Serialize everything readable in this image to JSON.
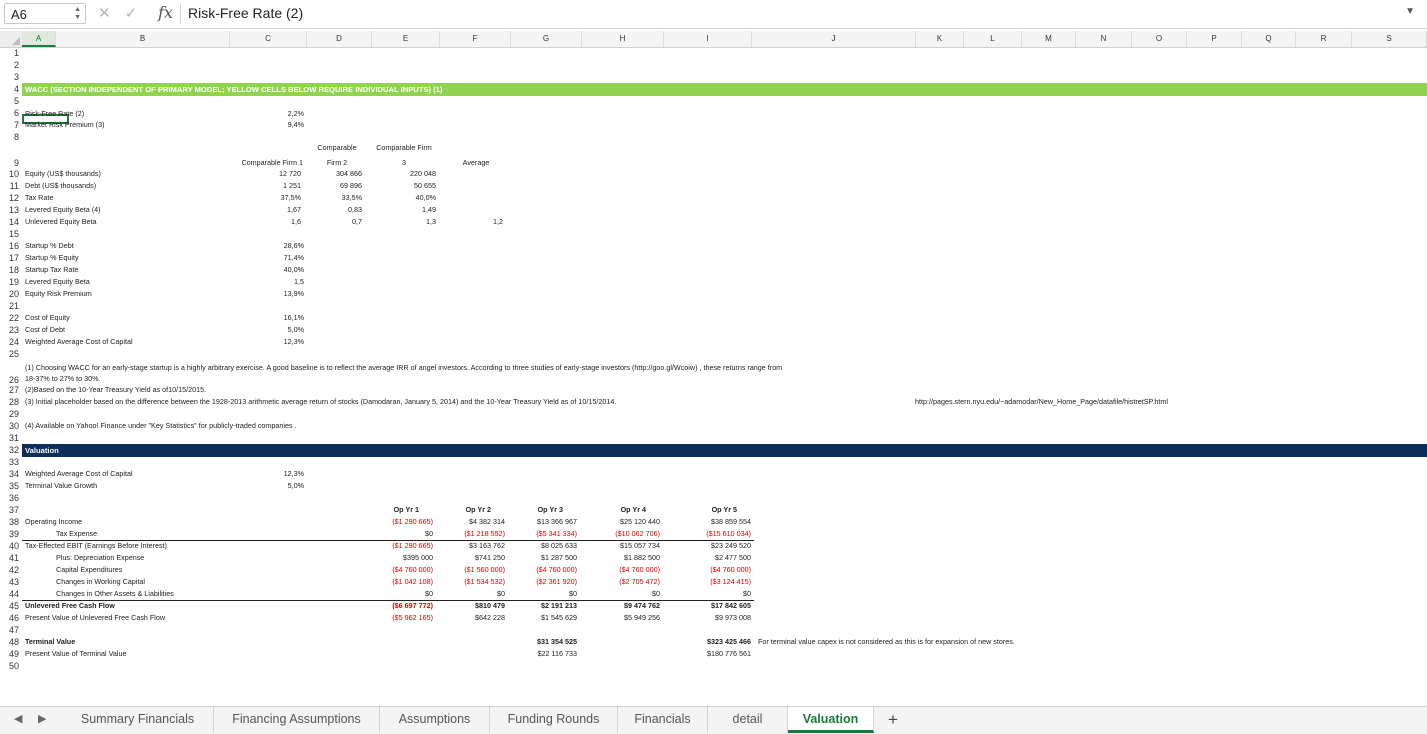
{
  "formula_bar": {
    "cell_ref": "A6",
    "cancel_icon": "✕",
    "confirm_icon": "✓",
    "fx": "fx",
    "content": "Risk-Free Rate (2)"
  },
  "columns": [
    "A",
    "B",
    "C",
    "D",
    "E",
    "F",
    "G",
    "H",
    "I",
    "J",
    "K",
    "L",
    "M",
    "N",
    "O",
    "P",
    "Q",
    "R",
    "S"
  ],
  "rows": [
    "1",
    "2",
    "3",
    "4",
    "5",
    "6",
    "7",
    "8",
    "9",
    "10",
    "11",
    "12",
    "13",
    "14",
    "15",
    "16",
    "17",
    "18",
    "19",
    "20",
    "21",
    "22",
    "23",
    "24",
    "25",
    "26",
    "27",
    "28",
    "29",
    "30",
    "31",
    "32",
    "33",
    "34",
    "35",
    "36",
    "37",
    "38",
    "39",
    "40",
    "41",
    "42",
    "43",
    "44",
    "45",
    "46",
    "47",
    "48",
    "49",
    "50"
  ],
  "wacc": {
    "header": "WACC (SECTION INDEPENDENT OF PRIMARY MODEL; YELLOW CELLS BELOW REQUIRE INDIVIDUAL INPUTS) (1)",
    "risk_free_label": "Risk-Free Rate (2)",
    "risk_free": "2,2%",
    "mrp_label": "Market Risk Premium (3)",
    "mrp": "9,4%",
    "comp1_header": "Comparable Firm 1",
    "comp2_header_a": "Comparable",
    "comp2_header_b": "Firm 2",
    "comp3_header_a": "Comparable Firm",
    "comp3_header_b": "3",
    "avg_header": "Average",
    "rows": [
      {
        "label": "Equity (US$ thousands)",
        "c1": "12 720",
        "c2": "304 866",
        "c3": "220 048",
        "avg": ""
      },
      {
        "label": "Debt (US$ thousands)",
        "c1": "1 251",
        "c2": "69 896",
        "c3": "50 655",
        "avg": ""
      },
      {
        "label": "Tax Rate",
        "c1": "37,5%",
        "c2": "33,5%",
        "c3": "40,0%",
        "avg": ""
      },
      {
        "label": "Levered Equity Beta (4)",
        "c1": "1,67",
        "c2": "0,83",
        "c3": "1,49",
        "avg": ""
      },
      {
        "label": "Unlevered Equity Beta",
        "c1": "1,6",
        "c2": "0,7",
        "c3": "1,3",
        "avg": "1,2"
      }
    ],
    "startup": [
      {
        "label": "Startup % Debt",
        "value": "28,6%"
      },
      {
        "label": "Startup % Equity",
        "value": "71,4%"
      },
      {
        "label": "Startup Tax Rate",
        "value": "40,0%"
      },
      {
        "label": "Levered Equity Beta",
        "value": "1,5"
      },
      {
        "label": "Equity Risk Premium",
        "value": "13,9%"
      }
    ],
    "costs": [
      {
        "label": "Cost of Equity",
        "value": "16,1%"
      },
      {
        "label": "Cost of Debt",
        "value": "5,0%"
      },
      {
        "label": "Weighted Average Cost of Capital",
        "value": "12,3%"
      }
    ],
    "notes": {
      "n1a": "(1) Choosing WACC for an early-stage startup is a highly arbitrary exercise.  A good baseline is to reflect the average IRR of angel investors.  According to three studies of early-stage investors (http://goo.gl/Wcoiw) , these returns range from",
      "n1b": "18-37% to 27% to 30%.",
      "n2": "(2)Based on the 10-Year Treasury Yield as of10/15/2015.",
      "n3": "(3) Initial placeholder based on the difference between the 1928-2013 arithmetic average return of stocks (Damodaran, January 5, 2014) and the 10-Year Treasury Yield as of 10/15/2014.",
      "n3_url": "http://pages.stern.nyu.edu/~adamodar/New_Home_Page/datafile/histretSP.html",
      "n4": "(4) Available on Yahoo! Finance under \"Key Statistics\" for publicly-traded companies ."
    }
  },
  "valuation": {
    "header": "Valuation",
    "wacc_label": "Weighted Average Cost of Capital",
    "wacc": "12,3%",
    "tvg_label": "Terminal Value Growth",
    "tvg": "5,0%",
    "years": [
      "Op Yr 1",
      "Op Yr 2",
      "Op Yr 3",
      "Op Yr 4",
      "Op Yr 5"
    ],
    "lines": [
      {
        "label": "Operating Income",
        "indent": false,
        "bold": false,
        "values": [
          "($1 290 665)",
          "$4 382 314",
          "$13 366 967",
          "$25 120 440",
          "$38 859 554"
        ],
        "neg": [
          true,
          false,
          false,
          false,
          false
        ]
      },
      {
        "label": "Tax Expense",
        "indent": true,
        "bold": false,
        "values": [
          "$0",
          "($1 218 552)",
          "($5 341 334)",
          "($10 062 706)",
          "($15 610 034)"
        ],
        "neg": [
          false,
          true,
          true,
          true,
          true
        ]
      },
      {
        "label": "Tax-Effected EBIT (Earnings Before Interest)",
        "indent": false,
        "bold": false,
        "values": [
          "($1 290 665)",
          "$3 163 762",
          "$8 025 633",
          "$15 057 734",
          "$23 249 520"
        ],
        "neg": [
          true,
          false,
          false,
          false,
          false
        ]
      },
      {
        "label": "Plus: Depreciation Expense",
        "indent": true,
        "bold": false,
        "values": [
          "$395 000",
          "$741 250",
          "$1 287 500",
          "$1 882 500",
          "$2 477 500"
        ],
        "neg": [
          false,
          false,
          false,
          false,
          false
        ]
      },
      {
        "label": "Capital Expenditures",
        "indent": true,
        "bold": false,
        "values": [
          "($4 760 000)",
          "($1 560 000)",
          "($4 760 000)",
          "($4 760 000)",
          "($4 760 000)"
        ],
        "neg": [
          true,
          true,
          true,
          true,
          true
        ]
      },
      {
        "label": "Changes in Working Capital",
        "indent": true,
        "bold": false,
        "values": [
          "($1 042 108)",
          "($1 534 532)",
          "($2 361 920)",
          "($2 705 472)",
          "($3 124 415)"
        ],
        "neg": [
          true,
          true,
          true,
          true,
          true
        ]
      },
      {
        "label": "Changes in Other Assets & Liabilities",
        "indent": true,
        "bold": false,
        "values": [
          "$0",
          "$0",
          "$0",
          "$0",
          "$0"
        ],
        "neg": [
          false,
          false,
          false,
          false,
          false
        ]
      },
      {
        "label": "Unlevered Free Cash Flow",
        "indent": false,
        "bold": true,
        "values": [
          "($6 697 772)",
          "$810 479",
          "$2 191 213",
          "$9 474 762",
          "$17 842 605"
        ],
        "neg": [
          true,
          false,
          false,
          false,
          false
        ]
      },
      {
        "label": "Present Value of Unlevered Free Cash Flow",
        "indent": false,
        "bold": false,
        "values": [
          "($5 962 165)",
          "$642 228",
          "$1 545 629",
          "$5 949 256",
          "$9 973 008"
        ],
        "neg": [
          true,
          false,
          false,
          false,
          false
        ]
      }
    ],
    "tv_label": "Terminal Value",
    "tv_g": "$31 354 525",
    "tv_i": "$323 425 466",
    "tv_note": "For terminal value capex is not considered as this is for expansion of new stores.",
    "pvtv_label": "Present Value of Terminal Value",
    "pvtv_g": "$22 116 733",
    "pvtv_i": "$180 776 561"
  },
  "tabs": {
    "prev_icon": "◀",
    "next_icon": "▶",
    "add_icon": "+",
    "items": [
      "Summary Financials",
      "Financing Assumptions",
      "Assumptions",
      "Funding Rounds",
      "Financials",
      "detail",
      "Valuation"
    ],
    "active": "Valuation"
  }
}
